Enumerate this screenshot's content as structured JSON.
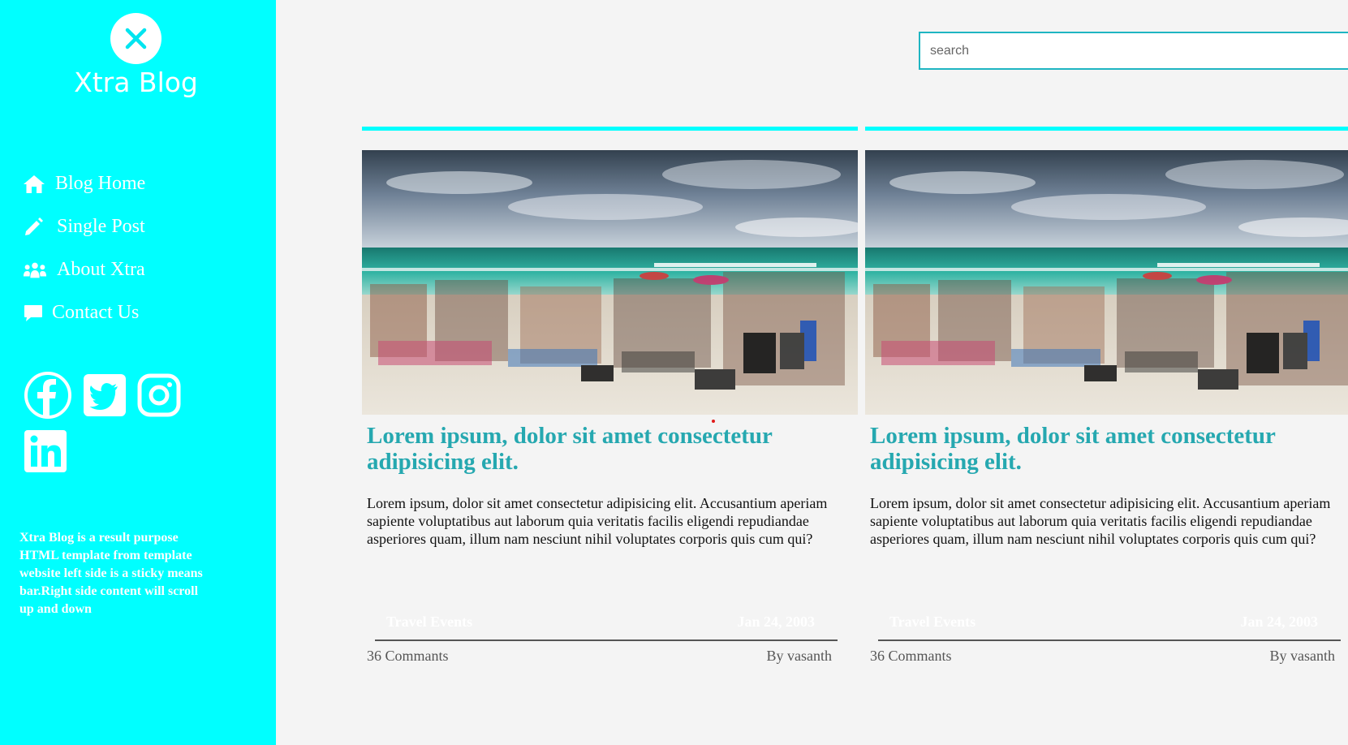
{
  "sidebar": {
    "brand": "Xtra Blog",
    "nav": [
      {
        "label": "Blog Home",
        "icon": "home-icon"
      },
      {
        "label": "Single Post",
        "icon": "pencil-icon"
      },
      {
        "label": "About Xtra",
        "icon": "users-icon"
      },
      {
        "label": "Contact Us",
        "icon": "comment-icon"
      }
    ],
    "socials": [
      "facebook-icon",
      "twitter-icon",
      "instagram-icon",
      "linkedin-icon"
    ],
    "about": "Xtra Blog is a result purpose HTML template from template website left side is a sticky means bar.Right side content will scroll up and down"
  },
  "search": {
    "placeholder": "search"
  },
  "posts": [
    {
      "title": "Lorem ipsum, dolor sit amet consectetur adipisicing elit.",
      "excerpt": "Lorem ipsum, dolor sit amet consectetur adipisicing elit. Accusantium aperiam sapiente voluptatibus aut laborum quia veritatis facilis eligendi repudiandae asperiores quam, illum nam nesciunt nihil voluptates corporis quis cum qui?",
      "category": "Travel Events",
      "date": "Jan 24, 2003",
      "comments": "36 Commants",
      "author": "By vasanth"
    },
    {
      "title": "Lorem ipsum, dolor sit amet consectetur adipisicing elit.",
      "excerpt": "Lorem ipsum, dolor sit amet consectetur adipisicing elit. Accusantium aperiam sapiente voluptatibus aut laborum quia veritatis facilis eligendi repudiandae asperiores quam, illum nam nesciunt nihil voluptates corporis quis cum qui?",
      "category": "Travel Events",
      "date": "Jan 24, 2003",
      "comments": "36 Commants",
      "author": "By vasanth"
    }
  ],
  "colors": {
    "accent": "#00ffff",
    "title": "#26a8b0",
    "background": "#f4f4f4"
  }
}
